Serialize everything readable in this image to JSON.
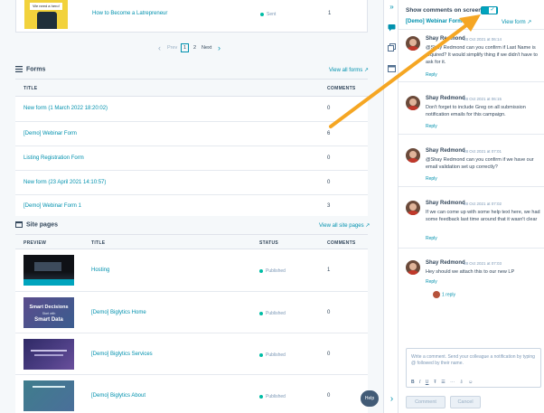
{
  "top_row": {
    "thumb_text": "We need a hero!",
    "title": "How to Become a Latrepreneur",
    "status": "Sent",
    "count": "1"
  },
  "pagination": {
    "prev": "Prev",
    "pages": [
      "1",
      "2"
    ],
    "next": "Next"
  },
  "forms": {
    "heading": "Forms",
    "view_all": "View all forms",
    "col_title": "TITLE",
    "col_comments": "COMMENTS",
    "rows": [
      {
        "title": "New form (1 March 2022 18:20:02)",
        "count": "0"
      },
      {
        "title": "[Demo] Webinar Form",
        "count": "6"
      },
      {
        "title": "Listing Registration Form",
        "count": "0"
      },
      {
        "title": "New form (23 April 2021 14:10:57)",
        "count": "0"
      },
      {
        "title": "[Demo] Webinar Form 1",
        "count": "3"
      }
    ]
  },
  "site_pages": {
    "heading": "Site pages",
    "view_all": "View all site pages",
    "col_preview": "PREVIEW",
    "col_title": "TITLE",
    "col_status": "STATUS",
    "col_comments": "COMMENTS",
    "rows": [
      {
        "title": "Hosting",
        "status": "Published",
        "count": "1",
        "thumb_lines": []
      },
      {
        "title": "[Demo] Biglytics Home",
        "status": "Published",
        "count": "0",
        "thumb_lines": [
          "Smart Decisions",
          "Start with",
          "Smart Data"
        ]
      },
      {
        "title": "[Demo] Biglytics Services",
        "status": "Published",
        "count": "0",
        "thumb_lines": []
      },
      {
        "title": "[Demo] Biglytics About",
        "status": "Published",
        "count": "0",
        "thumb_lines": []
      }
    ]
  },
  "help_label": "Help",
  "comments_panel": {
    "toggle_label": "Show comments on screen",
    "filter_label": "[Demo] Webinar Form",
    "view_form": "View form",
    "comments": [
      {
        "author": "Shay Redmond",
        "date": "28 Oct 2021 at 06:14",
        "text": "@Shay Redmond can you confirm if Last Name is required? It would simplify thing if we didn't have to ask for it.",
        "reply": "Reply"
      },
      {
        "author": "Shay Redmond",
        "date": "28 Oct 2021 at 06:15",
        "text": "Don't forget to include Greg on all submission notification emails for this campaign.",
        "reply": "Reply"
      },
      {
        "author": "Shay Redmond",
        "date": "28 Oct 2021 at 07:01",
        "text": "@Shay Redmond can you confirm if we have our email validation set up correctly?",
        "reply": "Reply"
      },
      {
        "author": "Shay Redmond",
        "date": "28 Oct 2021 at 07:02",
        "text": "If we can come up with some help text here, we had some feedback last time around that it wasn't clear",
        "reply": "Reply"
      },
      {
        "author": "Shay Redmond",
        "date": "28 Oct 2021 at 07:03",
        "text": "Hey should we attach this to our new LP",
        "reply": "Reply",
        "replies": "1 reply"
      }
    ],
    "composer_placeholder": "Write a comment. Send your colleague a notification by typing @ followed by their name.",
    "comment_btn": "Comment",
    "cancel_btn": "Cancel"
  },
  "colors": {
    "accent": "#0091ae",
    "arrow": "#f5a623",
    "published": "#00bda5"
  }
}
